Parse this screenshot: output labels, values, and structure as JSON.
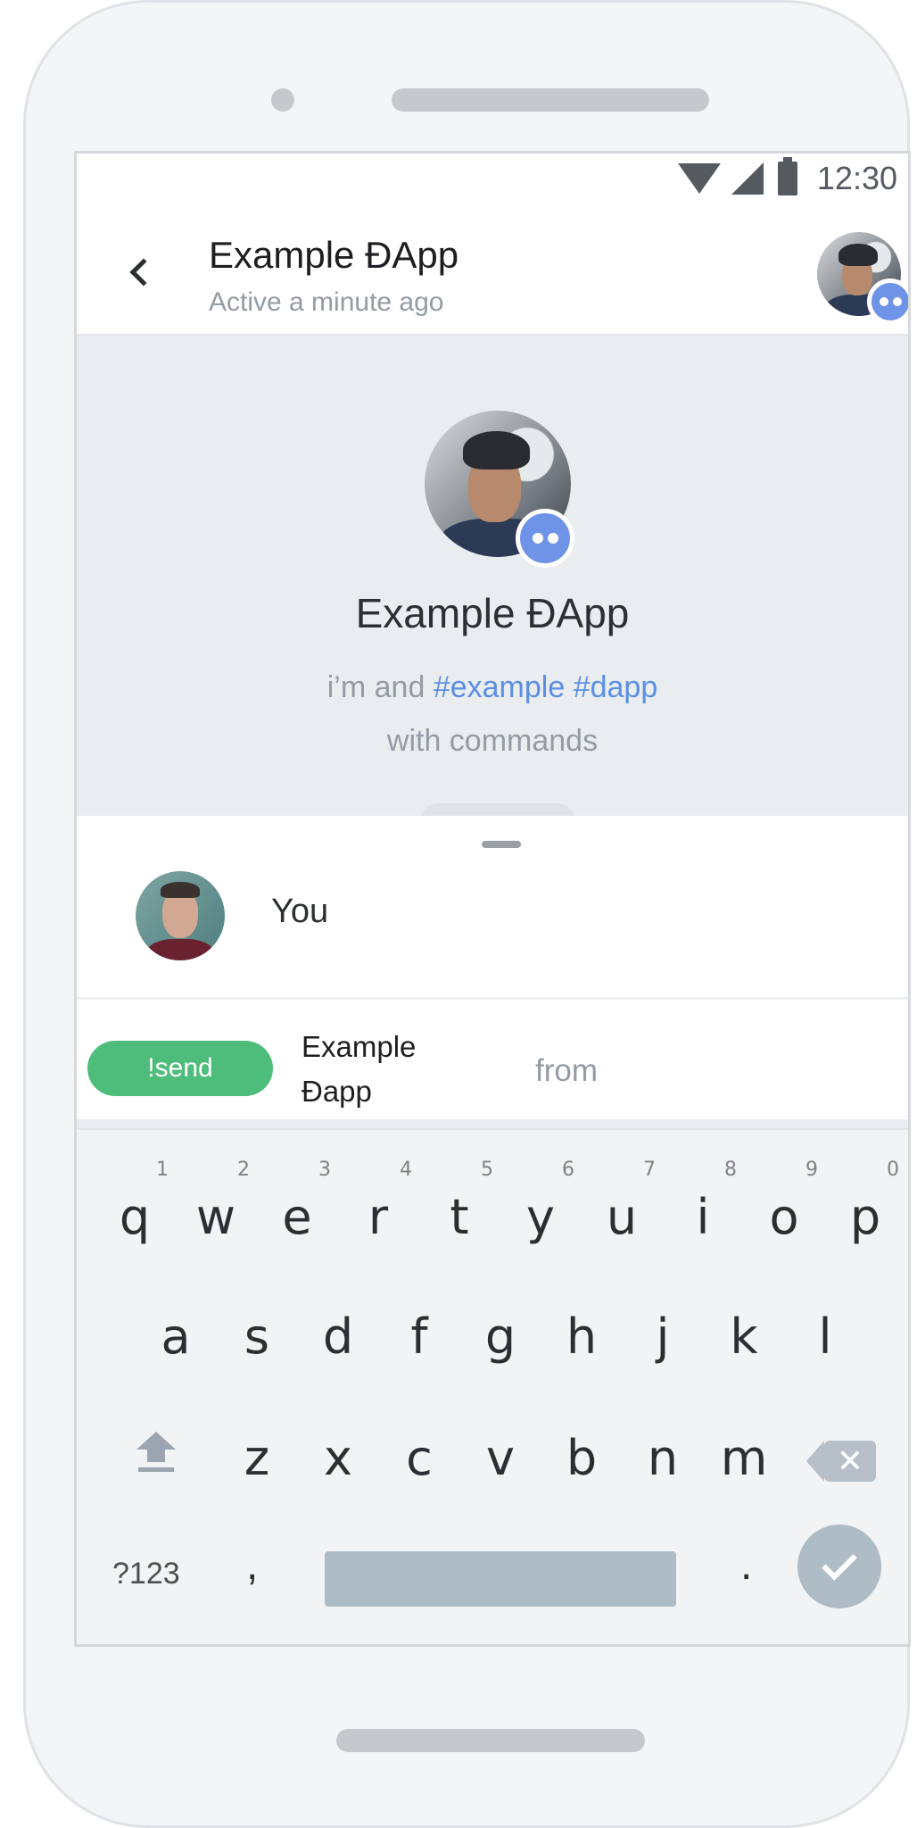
{
  "status_bar": {
    "time": "12:30"
  },
  "header": {
    "title": "Example ĐApp",
    "subtitle": "Active a minute ago"
  },
  "profile": {
    "name": "Example ĐApp",
    "description_prefix": "i’m and ",
    "hashtags": "#example #dapp",
    "description_line2": "with commands"
  },
  "suggestions": {
    "user_label": "You",
    "command": {
      "pill": "!send",
      "name": "Example Đapp",
      "argument": "from"
    }
  },
  "keyboard": {
    "row1": [
      {
        "key": "q",
        "num": "1"
      },
      {
        "key": "w",
        "num": "2"
      },
      {
        "key": "e",
        "num": "3"
      },
      {
        "key": "r",
        "num": "4"
      },
      {
        "key": "t",
        "num": "5"
      },
      {
        "key": "y",
        "num": "6"
      },
      {
        "key": "u",
        "num": "7"
      },
      {
        "key": "i",
        "num": "8"
      },
      {
        "key": "o",
        "num": "9"
      },
      {
        "key": "p",
        "num": "0"
      }
    ],
    "row2": [
      "a",
      "s",
      "d",
      "f",
      "g",
      "h",
      "j",
      "k",
      "l"
    ],
    "row3": [
      "z",
      "x",
      "c",
      "v",
      "b",
      "n",
      "m"
    ],
    "symbols_label": "?123",
    "comma": ",",
    "period": "."
  },
  "icons": {
    "back": "chevron-left-icon",
    "wifi": "wifi-icon",
    "signal": "signal-icon",
    "battery": "battery-icon",
    "shift": "shift-icon",
    "delete": "backspace-icon",
    "enter": "check-icon",
    "dapp_badge": "dapp-badge-icon"
  },
  "colors": {
    "accent_blue": "#5b8fe6",
    "badge_blue": "#6f93e6",
    "command_green": "#4ebc7a",
    "muted_text": "#939ba4"
  }
}
